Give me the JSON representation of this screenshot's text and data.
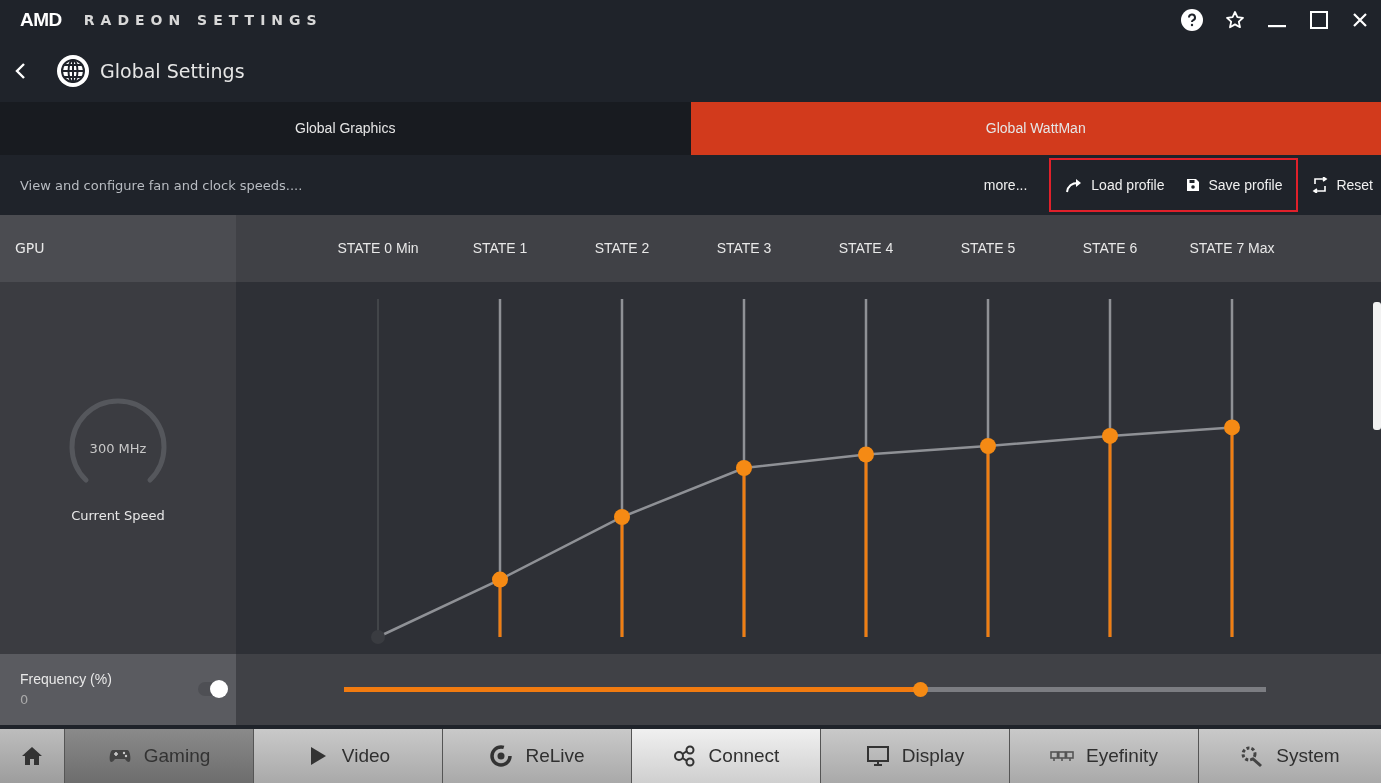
{
  "window": {
    "brand": "AMD",
    "title": "RADEON SETTINGS"
  },
  "header": {
    "title": "Global Settings"
  },
  "tabs": [
    {
      "label": "Global Graphics",
      "selected": false
    },
    {
      "label": "Global WattMan",
      "selected": true
    }
  ],
  "toolbar": {
    "description": "View and configure fan and clock speeds....",
    "more": "more...",
    "load": "Load profile",
    "save": "Save profile",
    "reset": "Reset"
  },
  "gpu": {
    "label": "GPU",
    "speed": "300 MHz",
    "speed_label": "Current Speed"
  },
  "states": [
    {
      "label": "STATE 0 Min",
      "level": 0,
      "disabled": true
    },
    {
      "label": "STATE 1",
      "level": 0.17,
      "disabled": false
    },
    {
      "label": "STATE 2",
      "level": 0.355,
      "disabled": false
    },
    {
      "label": "STATE 3",
      "level": 0.5,
      "disabled": false
    },
    {
      "label": "STATE 4",
      "level": 0.54,
      "disabled": false
    },
    {
      "label": "STATE 5",
      "level": 0.565,
      "disabled": false
    },
    {
      "label": "STATE 6",
      "level": 0.595,
      "disabled": false
    },
    {
      "label": "STATE 7 Max",
      "level": 0.62,
      "disabled": false
    }
  ],
  "frequency": {
    "label": "Frequency (%)",
    "value": "0",
    "on": true,
    "level": 0.625
  },
  "nav": [
    {
      "kind": "home",
      "selected": false,
      "hovered": false
    },
    {
      "kind": "gaming",
      "label": "Gaming",
      "selected": true,
      "hovered": false
    },
    {
      "kind": "video",
      "label": "Video",
      "selected": false,
      "hovered": false
    },
    {
      "kind": "relive",
      "label": "ReLive",
      "selected": false,
      "hovered": false
    },
    {
      "kind": "connect",
      "label": "Connect",
      "selected": false,
      "hovered": true
    },
    {
      "kind": "display",
      "label": "Display",
      "selected": false,
      "hovered": false
    },
    {
      "kind": "eyefinity",
      "label": "Eyefinity",
      "selected": false,
      "hovered": false
    },
    {
      "kind": "system",
      "label": "System",
      "selected": false,
      "hovered": false
    }
  ]
}
